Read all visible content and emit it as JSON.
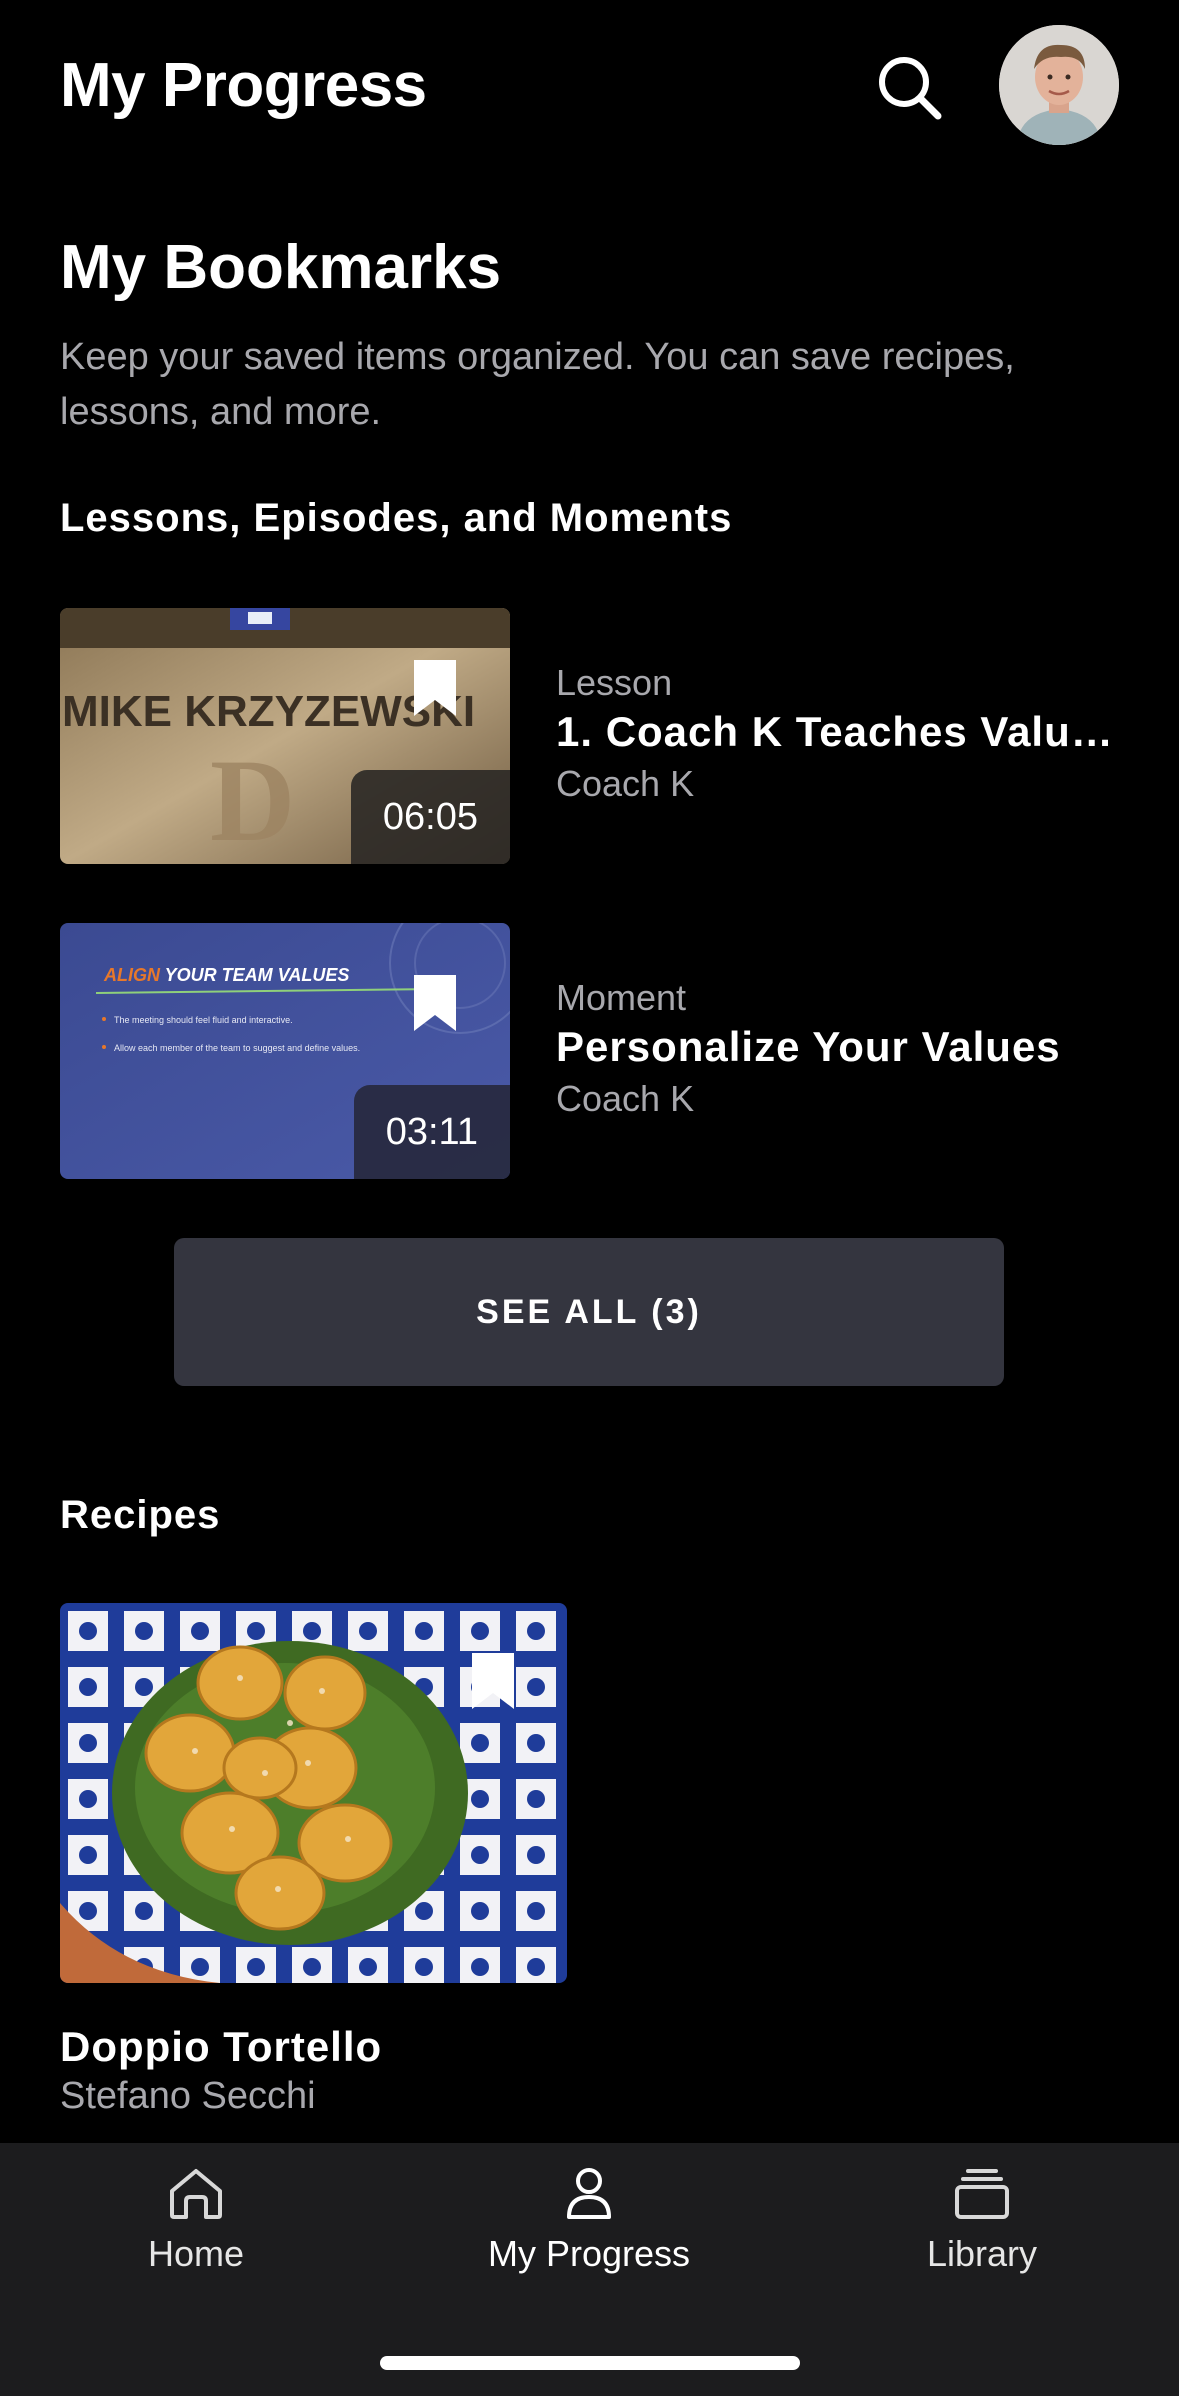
{
  "header": {
    "title": "My Progress",
    "search_icon": "search-icon",
    "avatar_icon": "user-avatar"
  },
  "bookmarks": {
    "title": "My Bookmarks",
    "description": "Keep your saved items organized. You can save recipes, lessons, and more."
  },
  "lessons_section": {
    "heading": "Lessons, Episodes, and Moments",
    "items": [
      {
        "type": "Lesson",
        "title": "1. Coach K Teaches Valu…",
        "author": "Coach K",
        "duration": "06:05",
        "thumb_text": "MIKE KRZYZEWSKI"
      },
      {
        "type": "Moment",
        "title": "Personalize Your Values",
        "author": "Coach K",
        "duration": "03:11",
        "slide_title_accent": "ALIGN",
        "slide_title_rest": " YOUR TEAM VALUES",
        "slide_bullet_1": "The meeting should feel fluid and interactive.",
        "slide_bullet_2": "Allow each member of the team to suggest and define values."
      }
    ],
    "see_all_label": "SEE ALL (3)"
  },
  "recipes_section": {
    "heading": "Recipes",
    "items": [
      {
        "title": "Doppio Tortello",
        "author": "Stefano Secchi"
      }
    ]
  },
  "tabbar": {
    "tabs": [
      {
        "label": "Home",
        "icon": "home-icon"
      },
      {
        "label": "My Progress",
        "icon": "person-icon"
      },
      {
        "label": "Library",
        "icon": "library-icon"
      }
    ]
  },
  "colors": {
    "background": "#000000",
    "secondary_text": "#a8a8ad",
    "button_bg": "#34353f",
    "tabbar_bg": "#1c1c1e"
  }
}
